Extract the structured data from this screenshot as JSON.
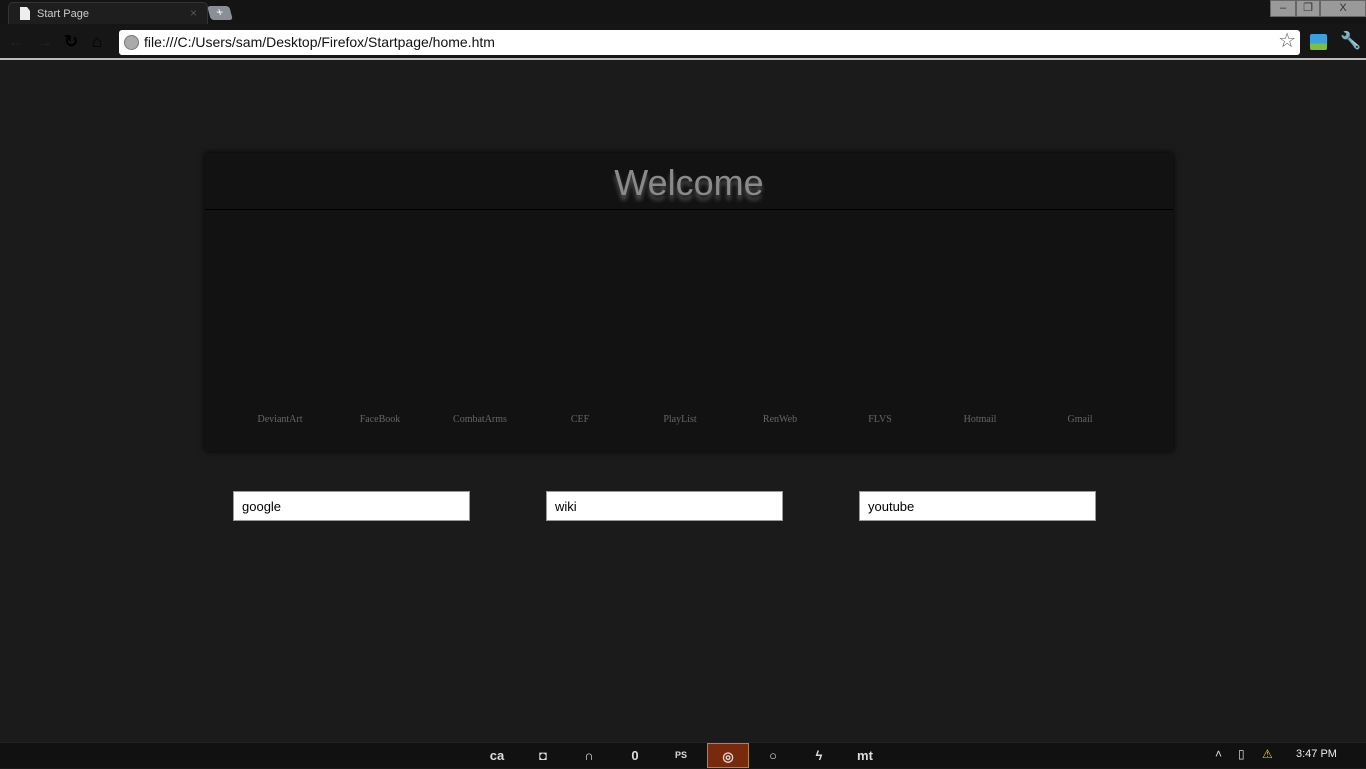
{
  "browser": {
    "tab_title": "Start Page",
    "tab_close": "×",
    "new_tab": "+",
    "url": "file:///C:/Users/sam/Desktop/Firefox/Startpage/home.htm",
    "window_controls": [
      "–",
      "❐",
      "X"
    ]
  },
  "page": {
    "title": "Welcome",
    "links": [
      "DeviantArt",
      "FaceBook",
      "CombatArms",
      "CEF",
      "PlayList",
      "RenWeb",
      "FLVS",
      "Hotmail",
      "Gmail"
    ],
    "searches": [
      {
        "value": "google"
      },
      {
        "value": "wiki"
      },
      {
        "value": "youtube"
      }
    ]
  },
  "taskbar": {
    "items": [
      "ca",
      "◘",
      "∩",
      "0",
      "PS",
      "◎",
      "○",
      "ϟ",
      "mt"
    ],
    "clock": "3:47 PM",
    "tray": [
      "˄",
      "▯",
      "⚠"
    ]
  },
  "colors": {
    "active_task": "#7a2a0c",
    "background": "#1b1b1b"
  }
}
